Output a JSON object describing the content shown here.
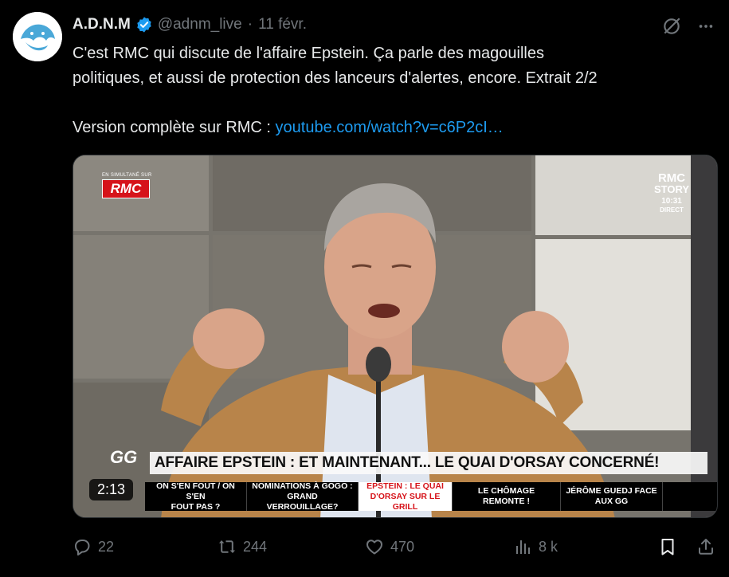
{
  "author": {
    "name": "A.D.N.M",
    "handle": "@adnm_live",
    "separator": "·",
    "date": "11 févr.",
    "verified": true
  },
  "tweet": {
    "line1": "C'est RMC qui discute de l'affaire Epstein. Ça parle des magouilles",
    "line2": "politiques, et aussi de protection des lanceurs d'alertes, encore. Extrait 2/2",
    "line3_prefix": "Version complète sur RMC : ",
    "link_text": "youtube.com/watch?v=c6P2cI…"
  },
  "video": {
    "simulcast_label": "EN SIMULTANÉ SUR",
    "channel_logo": "RMC",
    "story_logo_line1": "RMC",
    "story_logo_line2": "STORY",
    "clock": "10:31",
    "live_label": "DIRECT",
    "show_logo": "GG",
    "headline": "AFFAIRE EPSTEIN : ET MAINTENANT... LE QUAI D'ORSAY CONCERNÉ!",
    "ticker": [
      {
        "l1": "ON S'EN FOUT / ON S'EN",
        "l2": "FOUT PAS ?"
      },
      {
        "l1": "NOMINATIONS À GOGO :",
        "l2": "GRAND VERROUILLAGE?"
      },
      {
        "l1": "EPSTEIN : LE QUAI",
        "l2": "D'ORSAY SUR LE GRILL"
      },
      {
        "l1": "LE CHÔMAGE REMONTE !",
        "l2": ""
      },
      {
        "l1": "JÉRÔME GUEDJ FACE",
        "l2": "AUX GG"
      }
    ],
    "duration": "2:13"
  },
  "actions": {
    "replies": "22",
    "reposts": "244",
    "likes": "470",
    "views": "8 k"
  },
  "colors": {
    "background": "#000000",
    "text": "#e7e9ea",
    "muted": "#71767b",
    "link": "#1d9bf0",
    "verified": "#1d9bf0",
    "rmc_red": "#d6131a"
  },
  "icons": [
    "avatar-logo",
    "verified-badge-icon",
    "grok-icon",
    "more-icon",
    "reply-icon",
    "repost-icon",
    "like-icon",
    "views-icon",
    "bookmark-icon",
    "share-icon"
  ]
}
